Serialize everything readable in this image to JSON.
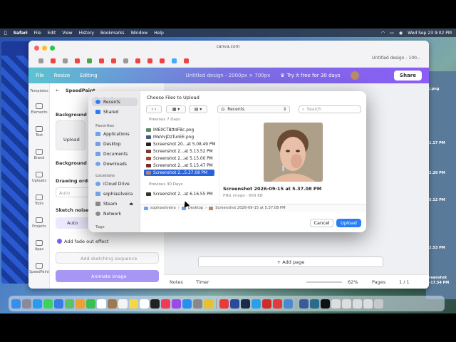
{
  "menubar": {
    "apple": "",
    "app": "Safari",
    "items": [
      "File",
      "Edit",
      "View",
      "History",
      "Bookmarks",
      "Window",
      "Help"
    ],
    "datetime": "Wed Sep 23  9:02 PM"
  },
  "browser": {
    "url": "canva.com",
    "tab_title": "Untitled design - 100..."
  },
  "canva": {
    "file": "File",
    "resize": "Resize",
    "editing": "Editing",
    "design_title": "Untitled design - 2000px × 700px",
    "try": "Try it free for 30 days",
    "share": "Share",
    "sidebar": [
      "Templates",
      "Elements",
      "Text",
      "Brand",
      "Uploads",
      "Tools",
      "Projects",
      "Apps",
      "SpeedPaint"
    ],
    "panel": {
      "app_name": "SpeedPaint",
      "background": "Background",
      "upload": "Upload",
      "background_color": "Background col",
      "drawing_order": "Drawing order",
      "auto_select": "Auto",
      "sketch_noise": "Sketch noise re",
      "auto": "Auto",
      "fade_out": "Add fade out effect",
      "add_sketch": "Add sketching sequence",
      "animate": "Animate image"
    },
    "add_page": "+ Add page",
    "notes": "Notes",
    "timer": "Timer",
    "zoom": "62%",
    "pages": "Pages",
    "page_count": "1 / 1"
  },
  "dialog": {
    "title": "Choose Files to Upload",
    "sidebar": {
      "recents": "Recents",
      "shared": "Shared",
      "favorites_header": "Favorites",
      "applications": "Applications",
      "desktop": "Desktop",
      "documents": "Documents",
      "downloads": "Downloads",
      "locations_header": "Locations",
      "icloud": "iCloud Drive",
      "user": "sophiasilveira",
      "steam": "Steam",
      "network": "Network",
      "tags_header": "Tags"
    },
    "location": "Recents",
    "search_placeholder": "Search",
    "section_7": "Previous 7 Days",
    "files_7": [
      "IME0CTBttdFBc.png",
      "lMeVvJDzTunEE.png",
      "Screenshot 20...at 5.08.49 PM",
      "Screenshot 2...at 5.13.52 PM",
      "Screenshot 2...at 5.15.00 PM",
      "Screenshot 2...at 5.15.47 PM",
      "Screenshot 2...5.37.08 PM"
    ],
    "section_30": "Previous 30 Days",
    "files_30": [
      "Screenshot 2...at 6.16.55 PM"
    ],
    "preview_name": "Screenshot 2026-09-15 at 5.37.08 PM",
    "preview_info": "PNG image - 669 KB",
    "path": [
      "sophiasilveira",
      "Desktop",
      "Screenshot 2026-09-15 at 5.37.08 PM"
    ],
    "cancel": "Cancel",
    "upload": "Upload"
  },
  "desktop_labels": [
    "/.png",
    "1.17 PM",
    "2.29 PM",
    "5.12 PM",
    "2.53 PM",
    "reenshot",
    "-17.54 PM"
  ]
}
